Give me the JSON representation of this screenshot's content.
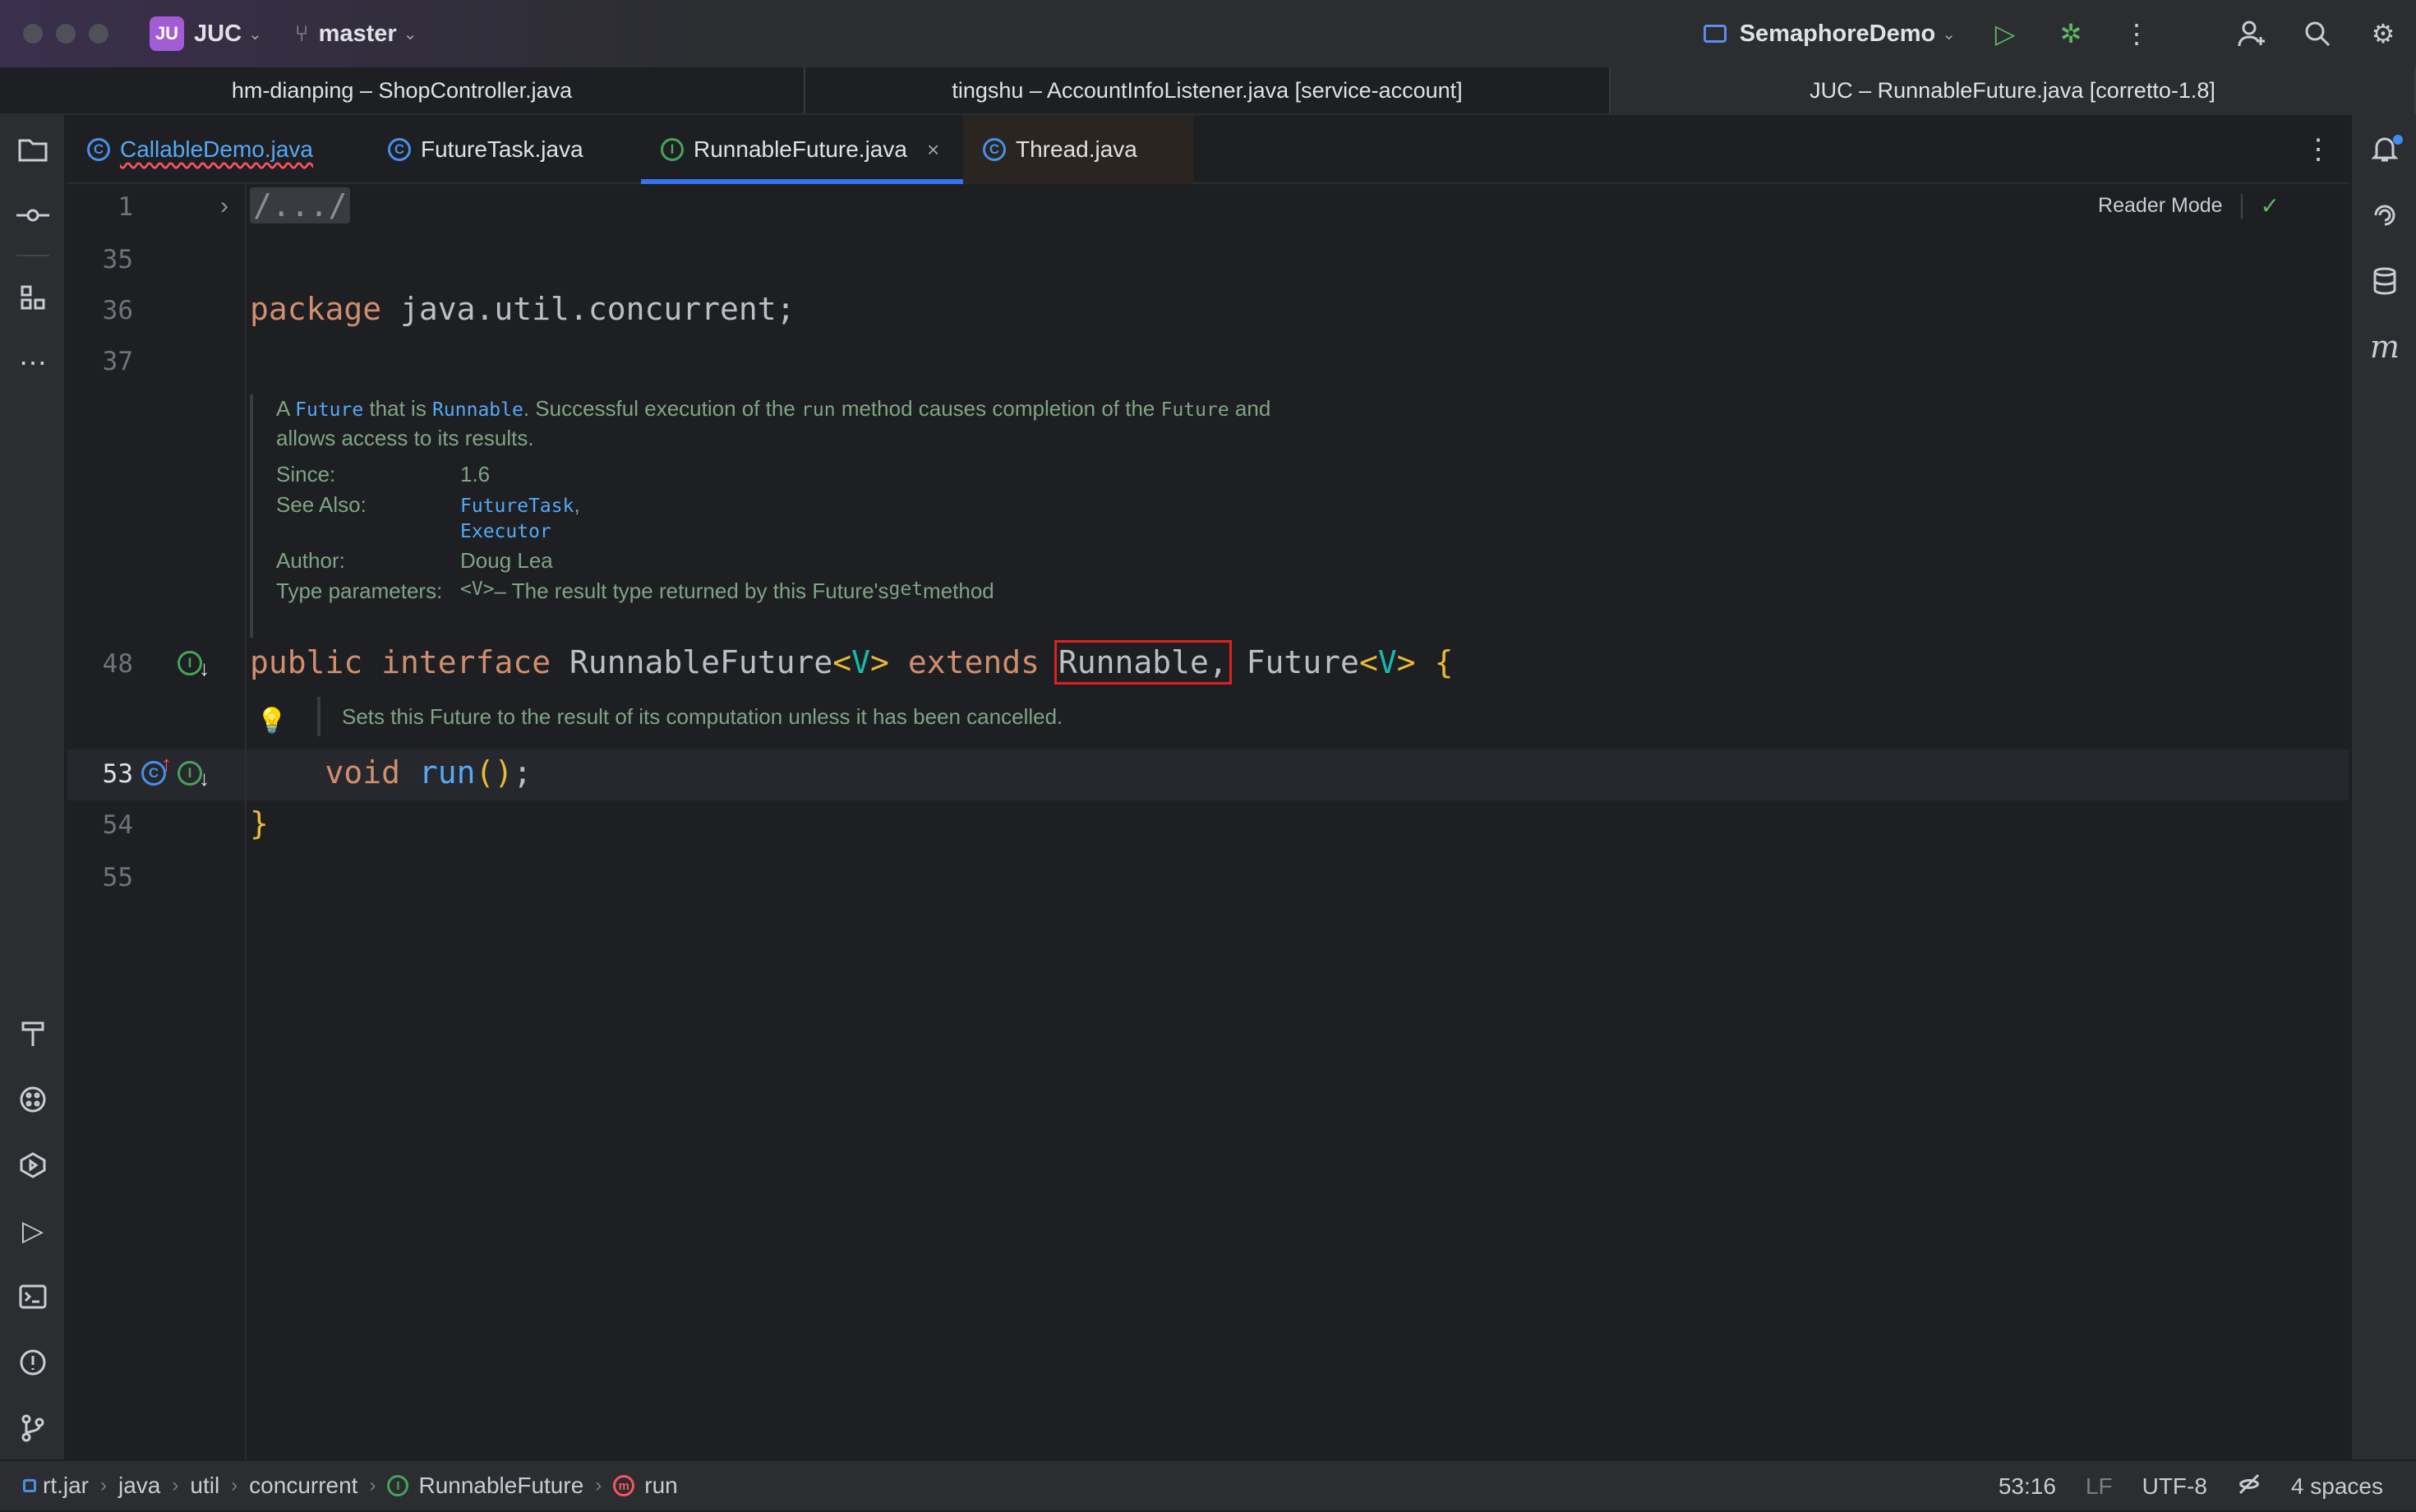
{
  "titlebar": {
    "project_badge": "JU",
    "project_name": "JUC",
    "branch": "master",
    "run_config": "SemaphoreDemo"
  },
  "window_tabs": [
    {
      "label": "hm-dianping – ShopController.java"
    },
    {
      "label": "tingshu – AccountInfoListener.java [service-account]"
    },
    {
      "label": "JUC – RunnableFuture.java [corretto-1.8]"
    }
  ],
  "editor_tabs": [
    {
      "label": "CallableDemo.java",
      "icon": "C"
    },
    {
      "label": "FutureTask.java",
      "icon": "C"
    },
    {
      "label": "RunnableFuture.java",
      "icon": "I",
      "close": "×"
    },
    {
      "label": "Thread.java",
      "icon": "C"
    }
  ],
  "editor": {
    "reader_mode": "Reader Mode",
    "lines": {
      "l1": "1",
      "l35": "35",
      "l36": "36",
      "l37": "37",
      "l48": "48",
      "l53": "53",
      "l54": "54",
      "l55": "55"
    },
    "fold": "/.../",
    "package_kw": "package",
    "package_name": " java.util.concurrent;",
    "decl": {
      "public": "public",
      "interface": "interface",
      "name": "RunnableFuture",
      "lt": "<",
      "type_param": "V",
      "gt": ">",
      "extends": "extends",
      "runnable": "Runnable,",
      "future": "Future",
      "open_brace": "{"
    },
    "method": {
      "void": "void",
      "name": "run",
      "parens": "()",
      "semi": ";"
    },
    "close_brace": "}",
    "doc": {
      "p1_a": "A ",
      "p1_future": "Future",
      "p1_b": " that is ",
      "p1_runnable": "Runnable",
      "p1_c": ". Successful execution of the ",
      "p1_run": "run",
      "p1_d": " method causes completion of the ",
      "p1_future2": "Future",
      "p1_e": " and",
      "p2": "allows access to its results.",
      "since_key": "Since:",
      "since_val": "1.6",
      "see_key": "See Also:",
      "see_1": "FutureTask",
      "see_comma": ",",
      "see_2": "Executor",
      "author_key": "Author:",
      "author_val": "Doug Lea",
      "type_key": "Type parameters:",
      "type_v": "<V>",
      "type_desc": " – The result type returned by this Future's ",
      "type_get": "get",
      "type_end": " method"
    },
    "run_doc": "Sets this Future to the result of its computation unless it has been cancelled."
  },
  "statusbar": {
    "crumbs": [
      "rt.jar",
      "java",
      "util",
      "concurrent",
      "RunnableFuture",
      "run"
    ],
    "position": "53:16",
    "line_sep": "LF",
    "encoding": "UTF-8",
    "indent": "4 spaces"
  }
}
